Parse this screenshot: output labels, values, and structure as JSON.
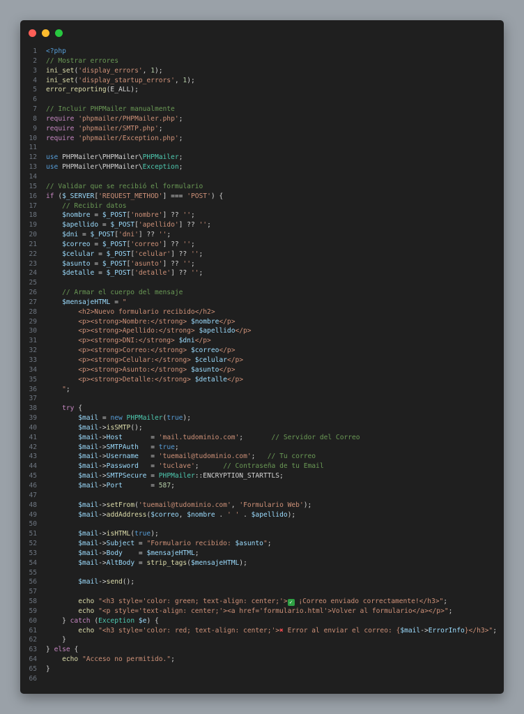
{
  "window": {
    "dots": [
      {
        "name": "close",
        "color": "#ff5f57"
      },
      {
        "name": "minimize",
        "color": "#febc2e"
      },
      {
        "name": "maximize",
        "color": "#28c840"
      }
    ]
  },
  "lines": [
    [
      [
        "kw",
        "<?php"
      ]
    ],
    [
      [
        "cm",
        "// Mostrar errores"
      ]
    ],
    [
      [
        "fn",
        "ini_set"
      ],
      [
        "src",
        "("
      ],
      [
        "str",
        "'display_errors'"
      ],
      [
        "src",
        ", "
      ],
      [
        "num",
        "1"
      ],
      [
        "src",
        ");"
      ]
    ],
    [
      [
        "fn",
        "ini_set"
      ],
      [
        "src",
        "("
      ],
      [
        "str",
        "'display_startup_errors'"
      ],
      [
        "src",
        ", "
      ],
      [
        "num",
        "1"
      ],
      [
        "src",
        ");"
      ]
    ],
    [
      [
        "fn",
        "error_reporting"
      ],
      [
        "src",
        "(E_ALL);"
      ]
    ],
    [],
    [
      [
        "cm",
        "// Incluir PHPMailer manualmente"
      ]
    ],
    [
      [
        "ct",
        "require"
      ],
      [
        "src",
        " "
      ],
      [
        "str",
        "'phpmailer/PHPMailer.php'"
      ],
      [
        "src",
        ";"
      ]
    ],
    [
      [
        "ct",
        "require"
      ],
      [
        "src",
        " "
      ],
      [
        "str",
        "'phpmailer/SMTP.php'"
      ],
      [
        "src",
        ";"
      ]
    ],
    [
      [
        "ct",
        "require"
      ],
      [
        "src",
        " "
      ],
      [
        "str",
        "'phpmailer/Exception.php'"
      ],
      [
        "src",
        ";"
      ]
    ],
    [],
    [
      [
        "kw",
        "use"
      ],
      [
        "src",
        " PHPMailer\\PHPMailer\\"
      ],
      [
        "cls",
        "PHPMailer"
      ],
      [
        "src",
        ";"
      ]
    ],
    [
      [
        "kw",
        "use"
      ],
      [
        "src",
        " PHPMailer\\PHPMailer\\"
      ],
      [
        "cls",
        "Exception"
      ],
      [
        "src",
        ";"
      ]
    ],
    [],
    [
      [
        "cm",
        "// Validar que se recibió el formulario"
      ]
    ],
    [
      [
        "ct",
        "if"
      ],
      [
        "src",
        " ("
      ],
      [
        "var",
        "$_SERVER"
      ],
      [
        "src",
        "["
      ],
      [
        "str",
        "'REQUEST_METHOD'"
      ],
      [
        "src",
        "] === "
      ],
      [
        "str",
        "'POST'"
      ],
      [
        "src",
        ") {"
      ]
    ],
    [
      [
        "src",
        "    "
      ],
      [
        "cm",
        "// Recibir datos"
      ]
    ],
    [
      [
        "src",
        "    "
      ],
      [
        "var",
        "$nombre"
      ],
      [
        "src",
        " = "
      ],
      [
        "var",
        "$_POST"
      ],
      [
        "src",
        "["
      ],
      [
        "str",
        "'nombre'"
      ],
      [
        "src",
        "] ?? "
      ],
      [
        "str",
        "''"
      ],
      [
        "src",
        ";"
      ]
    ],
    [
      [
        "src",
        "    "
      ],
      [
        "var",
        "$apellido"
      ],
      [
        "src",
        " = "
      ],
      [
        "var",
        "$_POST"
      ],
      [
        "src",
        "["
      ],
      [
        "str",
        "'apellido'"
      ],
      [
        "src",
        "] ?? "
      ],
      [
        "str",
        "''"
      ],
      [
        "src",
        ";"
      ]
    ],
    [
      [
        "src",
        "    "
      ],
      [
        "var",
        "$dni"
      ],
      [
        "src",
        " = "
      ],
      [
        "var",
        "$_POST"
      ],
      [
        "src",
        "["
      ],
      [
        "str",
        "'dni'"
      ],
      [
        "src",
        "] ?? "
      ],
      [
        "str",
        "''"
      ],
      [
        "src",
        ";"
      ]
    ],
    [
      [
        "src",
        "    "
      ],
      [
        "var",
        "$correo"
      ],
      [
        "src",
        " = "
      ],
      [
        "var",
        "$_POST"
      ],
      [
        "src",
        "["
      ],
      [
        "str",
        "'correo'"
      ],
      [
        "src",
        "] ?? "
      ],
      [
        "str",
        "''"
      ],
      [
        "src",
        ";"
      ]
    ],
    [
      [
        "src",
        "    "
      ],
      [
        "var",
        "$celular"
      ],
      [
        "src",
        " = "
      ],
      [
        "var",
        "$_POST"
      ],
      [
        "src",
        "["
      ],
      [
        "str",
        "'celular'"
      ],
      [
        "src",
        "] ?? "
      ],
      [
        "str",
        "''"
      ],
      [
        "src",
        ";"
      ]
    ],
    [
      [
        "src",
        "    "
      ],
      [
        "var",
        "$asunto"
      ],
      [
        "src",
        " = "
      ],
      [
        "var",
        "$_POST"
      ],
      [
        "src",
        "["
      ],
      [
        "str",
        "'asunto'"
      ],
      [
        "src",
        "] ?? "
      ],
      [
        "str",
        "''"
      ],
      [
        "src",
        ";"
      ]
    ],
    [
      [
        "src",
        "    "
      ],
      [
        "var",
        "$detalle"
      ],
      [
        "src",
        " = "
      ],
      [
        "var",
        "$_POST"
      ],
      [
        "src",
        "["
      ],
      [
        "str",
        "'detalle'"
      ],
      [
        "src",
        "] ?? "
      ],
      [
        "str",
        "''"
      ],
      [
        "src",
        ";"
      ]
    ],
    [],
    [
      [
        "src",
        "    "
      ],
      [
        "cm",
        "// Armar el cuerpo del mensaje"
      ]
    ],
    [
      [
        "src",
        "    "
      ],
      [
        "var",
        "$mensajeHTML"
      ],
      [
        "src",
        " = "
      ],
      [
        "str",
        "\""
      ]
    ],
    [
      [
        "str",
        "        <h2>Nuevo formulario recibido</h2>"
      ]
    ],
    [
      [
        "str",
        "        <p><strong>Nombre:</strong> "
      ],
      [
        "var",
        "$nombre"
      ],
      [
        "str",
        "</p>"
      ]
    ],
    [
      [
        "str",
        "        <p><strong>Apellido:</strong> "
      ],
      [
        "var",
        "$apellido"
      ],
      [
        "str",
        "</p>"
      ]
    ],
    [
      [
        "str",
        "        <p><strong>DNI:</strong> "
      ],
      [
        "var",
        "$dni"
      ],
      [
        "str",
        "</p>"
      ]
    ],
    [
      [
        "str",
        "        <p><strong>Correo:</strong> "
      ],
      [
        "var",
        "$correo"
      ],
      [
        "str",
        "</p>"
      ]
    ],
    [
      [
        "str",
        "        <p><strong>Celular:</strong> "
      ],
      [
        "var",
        "$celular"
      ],
      [
        "str",
        "</p>"
      ]
    ],
    [
      [
        "str",
        "        <p><strong>Asunto:</strong> "
      ],
      [
        "var",
        "$asunto"
      ],
      [
        "str",
        "</p>"
      ]
    ],
    [
      [
        "str",
        "        <p><strong>Detalle:</strong> "
      ],
      [
        "var",
        "$detalle"
      ],
      [
        "str",
        "</p>"
      ]
    ],
    [
      [
        "str",
        "    \""
      ],
      [
        "src",
        ";"
      ]
    ],
    [],
    [
      [
        "src",
        "    "
      ],
      [
        "ct",
        "try"
      ],
      [
        "src",
        " {"
      ]
    ],
    [
      [
        "src",
        "        "
      ],
      [
        "var",
        "$mail"
      ],
      [
        "src",
        " = "
      ],
      [
        "kw",
        "new"
      ],
      [
        "src",
        " "
      ],
      [
        "cls",
        "PHPMailer"
      ],
      [
        "src",
        "("
      ],
      [
        "kw",
        "true"
      ],
      [
        "src",
        ");"
      ]
    ],
    [
      [
        "src",
        "        "
      ],
      [
        "var",
        "$mail"
      ],
      [
        "src",
        "->"
      ],
      [
        "fn",
        "isSMTP"
      ],
      [
        "src",
        "();"
      ]
    ],
    [
      [
        "src",
        "        "
      ],
      [
        "var",
        "$mail"
      ],
      [
        "src",
        "->"
      ],
      [
        "var",
        "Host"
      ],
      [
        "src",
        "       = "
      ],
      [
        "str",
        "'mail.tudominio.com'"
      ],
      [
        "src",
        ";       "
      ],
      [
        "cm",
        "// Servidor del Correo"
      ]
    ],
    [
      [
        "src",
        "        "
      ],
      [
        "var",
        "$mail"
      ],
      [
        "src",
        "->"
      ],
      [
        "var",
        "SMTPAuth"
      ],
      [
        "src",
        "   = "
      ],
      [
        "kw",
        "true"
      ],
      [
        "src",
        ";"
      ]
    ],
    [
      [
        "src",
        "        "
      ],
      [
        "var",
        "$mail"
      ],
      [
        "src",
        "->"
      ],
      [
        "var",
        "Username"
      ],
      [
        "src",
        "   = "
      ],
      [
        "str",
        "'tuemail@tudominio.com'"
      ],
      [
        "src",
        ";   "
      ],
      [
        "cm",
        "// Tu correo"
      ]
    ],
    [
      [
        "src",
        "        "
      ],
      [
        "var",
        "$mail"
      ],
      [
        "src",
        "->"
      ],
      [
        "var",
        "Password"
      ],
      [
        "src",
        "   = "
      ],
      [
        "str",
        "'tuclave'"
      ],
      [
        "src",
        ";      "
      ],
      [
        "cm",
        "// Contraseña de tu Email"
      ]
    ],
    [
      [
        "src",
        "        "
      ],
      [
        "var",
        "$mail"
      ],
      [
        "src",
        "->"
      ],
      [
        "var",
        "SMTPSecure"
      ],
      [
        "src",
        " = "
      ],
      [
        "cls",
        "PHPMailer"
      ],
      [
        "src",
        "::ENCRYPTION_STARTTLS;"
      ]
    ],
    [
      [
        "src",
        "        "
      ],
      [
        "var",
        "$mail"
      ],
      [
        "src",
        "->"
      ],
      [
        "var",
        "Port"
      ],
      [
        "src",
        "       = "
      ],
      [
        "num",
        "587"
      ],
      [
        "src",
        ";"
      ]
    ],
    [],
    [
      [
        "src",
        "        "
      ],
      [
        "var",
        "$mail"
      ],
      [
        "src",
        "->"
      ],
      [
        "fn",
        "setFrom"
      ],
      [
        "src",
        "("
      ],
      [
        "str",
        "'tuemail@tudominio.com'"
      ],
      [
        "src",
        ", "
      ],
      [
        "str",
        "'Formulario Web'"
      ],
      [
        "src",
        ");"
      ]
    ],
    [
      [
        "src",
        "        "
      ],
      [
        "var",
        "$mail"
      ],
      [
        "src",
        "->"
      ],
      [
        "fn",
        "addAddress"
      ],
      [
        "src",
        "("
      ],
      [
        "var",
        "$correo"
      ],
      [
        "src",
        ", "
      ],
      [
        "var",
        "$nombre"
      ],
      [
        "src",
        " . "
      ],
      [
        "str",
        "' '"
      ],
      [
        "src",
        " . "
      ],
      [
        "var",
        "$apellido"
      ],
      [
        "src",
        ");"
      ]
    ],
    [],
    [
      [
        "src",
        "        "
      ],
      [
        "var",
        "$mail"
      ],
      [
        "src",
        "->"
      ],
      [
        "fn",
        "isHTML"
      ],
      [
        "src",
        "("
      ],
      [
        "kw",
        "true"
      ],
      [
        "src",
        ");"
      ]
    ],
    [
      [
        "src",
        "        "
      ],
      [
        "var",
        "$mail"
      ],
      [
        "src",
        "->"
      ],
      [
        "var",
        "Subject"
      ],
      [
        "src",
        " = "
      ],
      [
        "str",
        "\"Formulario recibido: "
      ],
      [
        "var",
        "$asunto"
      ],
      [
        "str",
        "\""
      ],
      [
        "src",
        ";"
      ]
    ],
    [
      [
        "src",
        "        "
      ],
      [
        "var",
        "$mail"
      ],
      [
        "src",
        "->"
      ],
      [
        "var",
        "Body"
      ],
      [
        "src",
        "    = "
      ],
      [
        "var",
        "$mensajeHTML"
      ],
      [
        "src",
        ";"
      ]
    ],
    [
      [
        "src",
        "        "
      ],
      [
        "var",
        "$mail"
      ],
      [
        "src",
        "->"
      ],
      [
        "var",
        "AltBody"
      ],
      [
        "src",
        " = "
      ],
      [
        "fn",
        "strip_tags"
      ],
      [
        "src",
        "("
      ],
      [
        "var",
        "$mensajeHTML"
      ],
      [
        "src",
        ");"
      ]
    ],
    [],
    [
      [
        "src",
        "        "
      ],
      [
        "var",
        "$mail"
      ],
      [
        "src",
        "->"
      ],
      [
        "fn",
        "send"
      ],
      [
        "src",
        "();"
      ]
    ],
    [],
    [
      [
        "src",
        "        "
      ],
      [
        "fn",
        "echo"
      ],
      [
        "src",
        " "
      ],
      [
        "str",
        "\"<h3 style='color: green; text-align: center;'>"
      ],
      [
        "check",
        "✓"
      ],
      [
        "str",
        " ¡Correo enviado correctamente!</h3>\""
      ],
      [
        "src",
        ";"
      ]
    ],
    [
      [
        "src",
        "        "
      ],
      [
        "fn",
        "echo"
      ],
      [
        "src",
        " "
      ],
      [
        "str",
        "\"<p style='text-align: center;'><a href='formulario.html'>Volver al formulario</a></p>\""
      ],
      [
        "src",
        ";"
      ]
    ],
    [
      [
        "src",
        "    } "
      ],
      [
        "ct",
        "catch"
      ],
      [
        "src",
        " ("
      ],
      [
        "cls",
        "Exception"
      ],
      [
        "src",
        " "
      ],
      [
        "var",
        "$e"
      ],
      [
        "src",
        ") {"
      ]
    ],
    [
      [
        "src",
        "        "
      ],
      [
        "fn",
        "echo"
      ],
      [
        "src",
        " "
      ],
      [
        "str",
        "\"<h3 style='color: red; text-align: center;'>"
      ],
      [
        "cross",
        "✖"
      ],
      [
        "str",
        " Error al enviar el correo: {"
      ],
      [
        "var",
        "$mail"
      ],
      [
        "src",
        "->"
      ],
      [
        "var",
        "ErrorInfo"
      ],
      [
        "str",
        "}</h3>\""
      ],
      [
        "src",
        ";"
      ]
    ],
    [
      [
        "src",
        "    }"
      ]
    ],
    [
      [
        "src",
        "} "
      ],
      [
        "ct",
        "else"
      ],
      [
        "src",
        " {"
      ]
    ],
    [
      [
        "src",
        "    "
      ],
      [
        "fn",
        "echo"
      ],
      [
        "src",
        " "
      ],
      [
        "str",
        "\"Acceso no permitido.\""
      ],
      [
        "src",
        ";"
      ]
    ],
    [
      [
        "src",
        "}"
      ]
    ],
    []
  ]
}
